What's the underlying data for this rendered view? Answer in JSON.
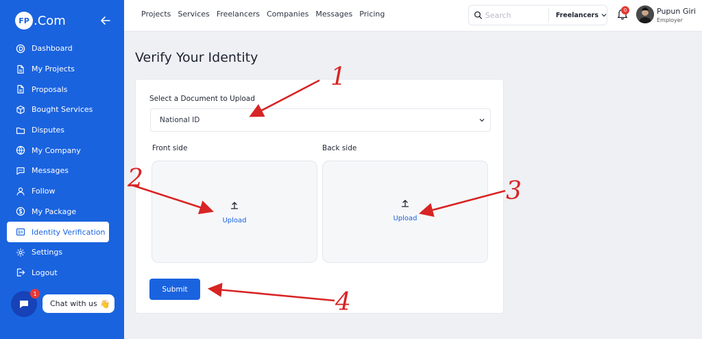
{
  "sidebar": {
    "logo_badge": "FP",
    "logo_text": ".Com",
    "items": [
      {
        "label": "Dashboard",
        "icon": "dashboard-icon"
      },
      {
        "label": "My Projects",
        "icon": "document-icon"
      },
      {
        "label": "Proposals",
        "icon": "document-icon"
      },
      {
        "label": "Bought Services",
        "icon": "box-icon"
      },
      {
        "label": "Disputes",
        "icon": "folder-icon"
      },
      {
        "label": "My Company",
        "icon": "globe-icon"
      },
      {
        "label": "Messages",
        "icon": "message-icon"
      },
      {
        "label": "Follow",
        "icon": "user-icon"
      },
      {
        "label": "My Package",
        "icon": "dollar-icon"
      },
      {
        "label": "Identity Verification",
        "icon": "id-card-icon",
        "active": true
      },
      {
        "label": "Settings",
        "icon": "gear-icon"
      },
      {
        "label": "Logout",
        "icon": "logout-icon"
      }
    ],
    "chat": {
      "badge": "1",
      "label": "Chat with us",
      "emoji": "👋"
    }
  },
  "topbar": {
    "nav": [
      "Projects",
      "Services",
      "Freelancers",
      "Companies",
      "Messages",
      "Pricing"
    ],
    "search_placeholder": "Search",
    "search_category": "Freelancers",
    "notification_count": "0",
    "user_name": "Pupun Giri",
    "user_role": "Employer"
  },
  "main": {
    "title": "Verify Your Identity",
    "select_label": "Select a Document to Upload",
    "select_value": "National ID",
    "front_label": "Front side",
    "back_label": "Back side",
    "upload_label": "Upload",
    "submit_label": "Submit"
  },
  "annotations": [
    "1",
    "2",
    "3",
    "4"
  ],
  "colors": {
    "primary": "#1a63df",
    "annotation": "#d82424",
    "badge": "#e53935"
  }
}
